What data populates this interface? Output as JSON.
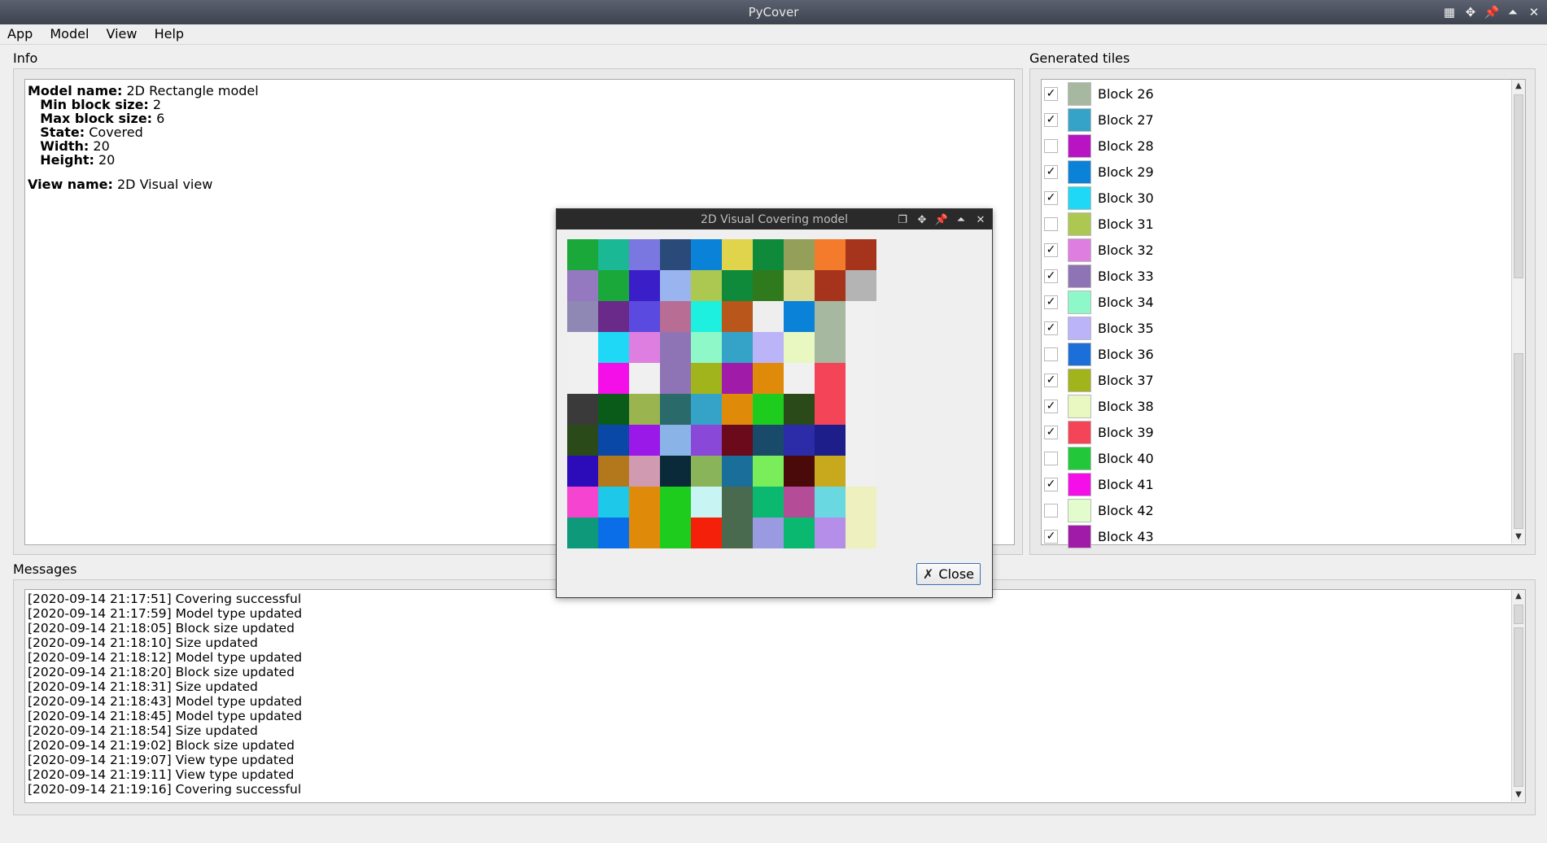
{
  "window": {
    "title": "PyCover"
  },
  "menu": [
    "App",
    "Model",
    "View",
    "Help"
  ],
  "info": {
    "label": "Info",
    "model_name_key": "Model name:",
    "model_name": "2D Rectangle model",
    "min_block_key": "Min block size:",
    "min_block": "2",
    "max_block_key": "Max block size:",
    "max_block": "6",
    "state_key": "State:",
    "state": "Covered",
    "width_key": "Width:",
    "width": "20",
    "height_key": "Height:",
    "height": "20",
    "view_name_key": "View name:",
    "view_name": "2D Visual view"
  },
  "tiles": {
    "label": "Generated tiles",
    "items": [
      {
        "label": "Block 26",
        "checked": true,
        "color": "#a6b8a0"
      },
      {
        "label": "Block 27",
        "checked": true,
        "color": "#35a3c8"
      },
      {
        "label": "Block 28",
        "checked": false,
        "color": "#b814c4"
      },
      {
        "label": "Block 29",
        "checked": true,
        "color": "#0a82d8"
      },
      {
        "label": "Block 30",
        "checked": true,
        "color": "#1ed8f6"
      },
      {
        "label": "Block 31",
        "checked": false,
        "color": "#acc850"
      },
      {
        "label": "Block 32",
        "checked": true,
        "color": "#de7ee0"
      },
      {
        "label": "Block 33",
        "checked": true,
        "color": "#8e74b4"
      },
      {
        "label": "Block 34",
        "checked": true,
        "color": "#8ef8c8"
      },
      {
        "label": "Block 35",
        "checked": true,
        "color": "#bcb4f8"
      },
      {
        "label": "Block 36",
        "checked": false,
        "color": "#1c6ed8"
      },
      {
        "label": "Block 37",
        "checked": true,
        "color": "#a2b41c"
      },
      {
        "label": "Block 38",
        "checked": true,
        "color": "#e8f8c0"
      },
      {
        "label": "Block 39",
        "checked": true,
        "color": "#f44458"
      },
      {
        "label": "Block 40",
        "checked": false,
        "color": "#22c83a"
      },
      {
        "label": "Block 41",
        "checked": true,
        "color": "#f40ee8"
      },
      {
        "label": "Block 42",
        "checked": false,
        "color": "#e2fcce"
      },
      {
        "label": "Block 43",
        "checked": true,
        "color": "#a01ca8"
      }
    ]
  },
  "messages": {
    "label": "Messages",
    "items": [
      "[2020-09-14 21:17:51] Covering successful",
      "[2020-09-14 21:17:59] Model type updated",
      "[2020-09-14 21:18:05] Block size updated",
      "[2020-09-14 21:18:10] Size updated",
      "[2020-09-14 21:18:12] Model type updated",
      "[2020-09-14 21:18:20] Block size updated",
      "[2020-09-14 21:18:31] Size updated",
      "[2020-09-14 21:18:43] Model type updated",
      "[2020-09-14 21:18:45] Model type updated",
      "[2020-09-14 21:18:54] Size updated",
      "[2020-09-14 21:19:02] Block size updated",
      "[2020-09-14 21:19:07] View type updated",
      "[2020-09-14 21:19:11] View type updated",
      "[2020-09-14 21:19:16] Covering successful"
    ]
  },
  "dialog": {
    "title": "2D Visual Covering model",
    "close_label": "Close",
    "grid": [
      [
        "#1aa83a",
        "#1ab894",
        "#7a78e0",
        "#2a4a7a",
        "#0a82d8",
        "#e0d44c",
        "#0e8a3a",
        "#94a05a",
        "#f47a2c",
        "#a6341c"
      ],
      [
        "#9478c0",
        "#1aa83a",
        "#3a1ec8",
        "#9ab4f0",
        "#acc850",
        "#0e8a3a",
        "#2e7a1c",
        "#dcdc90",
        "#a6341c",
        "#b4b4b4"
      ],
      [
        "#9088b4",
        "#6a2a8a",
        "#5a4ae0",
        "#b86e94",
        "#1ef0e0",
        "#b8561c",
        "#eeeeee",
        "#0a82d8",
        "#a6b8a0",
        "#f0f0f0"
      ],
      [
        "#f0f0f0",
        "#1ed8f6",
        "#de7ee0",
        "#8e74b4",
        "#8ef8c8",
        "#35a3c8",
        "#bcb4f8",
        "#e8f8c0",
        "#a6b8a0",
        "#f0f0f0"
      ],
      [
        "#f0f0f0",
        "#f40ee8",
        "#f0f0f0",
        "#8e74b4",
        "#a2b41c",
        "#a01ca8",
        "#e08a0a",
        "#f0f0f0",
        "#f44458",
        "#f0f0f0"
      ],
      [
        "#3a3a3a",
        "#0a5a1a",
        "#9ab450",
        "#2a6a6a",
        "#35a3c8",
        "#e08a0a",
        "#1ecc1e",
        "#2a4a1a",
        "#f44458",
        "#f0f0f0"
      ],
      [
        "#2a4a1a",
        "#0a48a8",
        "#9a18e8",
        "#8ab4e8",
        "#8a48d8",
        "#6a0a1a",
        "#1a4a6a",
        "#2c2ca8",
        "#1e1e8a",
        "#f0f0f0"
      ],
      [
        "#2c0cb8",
        "#b4781c",
        "#d09ab0",
        "#0a2a3a",
        "#8ab45a",
        "#1a6e9a",
        "#7aee5a",
        "#4a0a0a",
        "#c8a81c",
        "#f0f0f0"
      ],
      [
        "#f444d0",
        "#1ec8e8",
        "#e08a0a",
        "#1ecc1e",
        "#c8f4f4",
        "#4a6a50",
        "#0ab870",
        "#b44c98",
        "#6ad8e0",
        "#eef0c0"
      ],
      [
        "#0e9a7a",
        "#0a6ee8",
        "#e08a0a",
        "#1ecc1e",
        "#f4200a",
        "#4a6a50",
        "#9a9ae0",
        "#0ab870",
        "#b48ee8",
        "#eef0c0"
      ]
    ]
  }
}
